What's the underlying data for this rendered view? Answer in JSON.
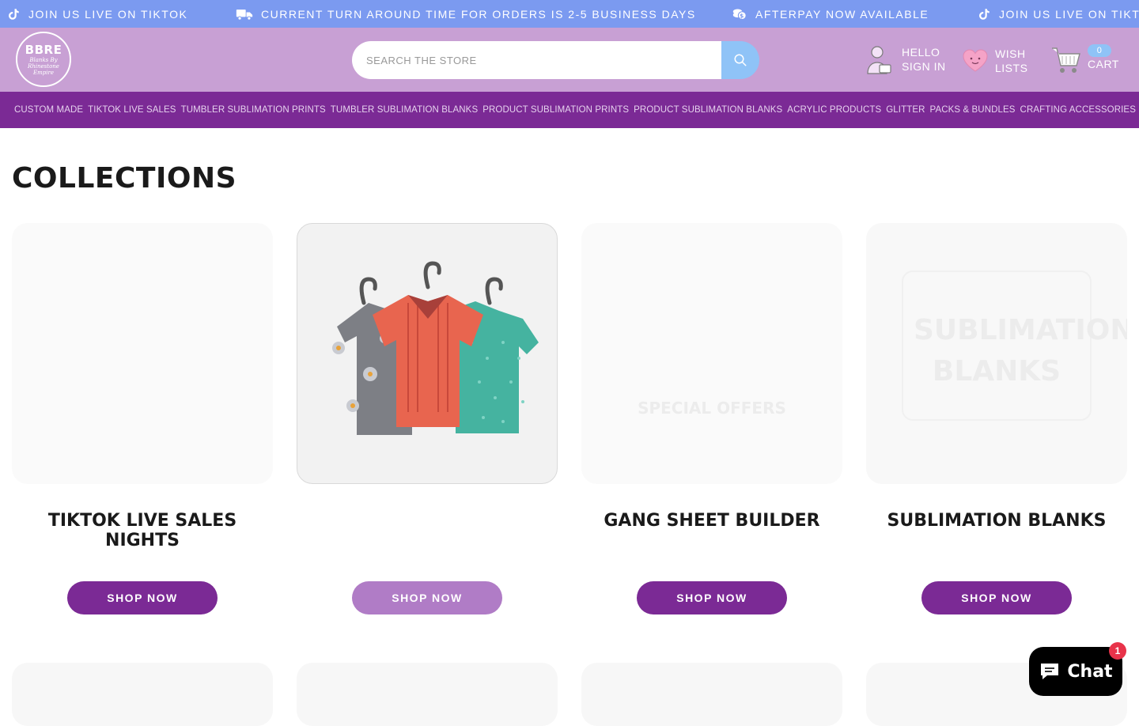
{
  "announcement": {
    "items": [
      {
        "icon": "tiktok-icon",
        "text": "JOIN US LIVE ON TIKTOK"
      },
      {
        "icon": "truck-icon",
        "text": "CURRENT TURN AROUND TIME FOR ORDERS IS 2-5 BUSINESS DAYS"
      },
      {
        "icon": "coins-icon",
        "text": "AFTERPAY NOW AVAILABLE"
      },
      {
        "icon": "tiktok-icon",
        "text": "JOIN US LIVE ON TIKTOK"
      }
    ]
  },
  "header": {
    "logo": {
      "line1": "BBRE",
      "line2": "Blanks By Rhinestone Empire"
    },
    "search": {
      "placeholder": "SEARCH THE STORE"
    },
    "account": {
      "line1": "HELLO",
      "line2": "SIGN IN"
    },
    "wishlist": {
      "line1": "WISH",
      "line2": "LISTS"
    },
    "cart": {
      "label": "CART",
      "count": "0"
    }
  },
  "nav": {
    "items": [
      "CUSTOM MADE",
      "TIKTOK LIVE SALES",
      "TUMBLER SUBLIMATION PRINTS",
      "TUMBLER SUBLIMATION BLANKS",
      "PRODUCT SUBLIMATION PRINTS",
      "PRODUCT SUBLIMATION BLANKS",
      "ACRYLIC PRODUCTS",
      "GLITTER",
      "PACKS & BUNDLES",
      "CRAFTING ACCESSORIES"
    ]
  },
  "main": {
    "title": "COLLECTIONS",
    "cards": [
      {
        "title": "TIKTOK LIVE SALES NIGHTS",
        "button": "SHOP NOW"
      },
      {
        "title": "",
        "button": "SHOP NOW"
      },
      {
        "title": "GANG SHEET BUILDER",
        "button": "SHOP NOW",
        "overlay": "SPECIAL OFFERS"
      },
      {
        "title": "SUBLIMATION BLANKS",
        "button": "SHOP NOW",
        "overlay_line1": "SUBLIMATION",
        "overlay_line2": "BLANKS"
      }
    ]
  },
  "chat": {
    "label": "Chat",
    "badge": "1"
  },
  "colors": {
    "announcement_bg": "#7b9af0",
    "header_bg": "#c8a0d4",
    "nav_bg": "#7b2a95",
    "button_primary": "#7b2a95",
    "button_light": "#b07cc6",
    "search_button": "#8fc3f7"
  }
}
